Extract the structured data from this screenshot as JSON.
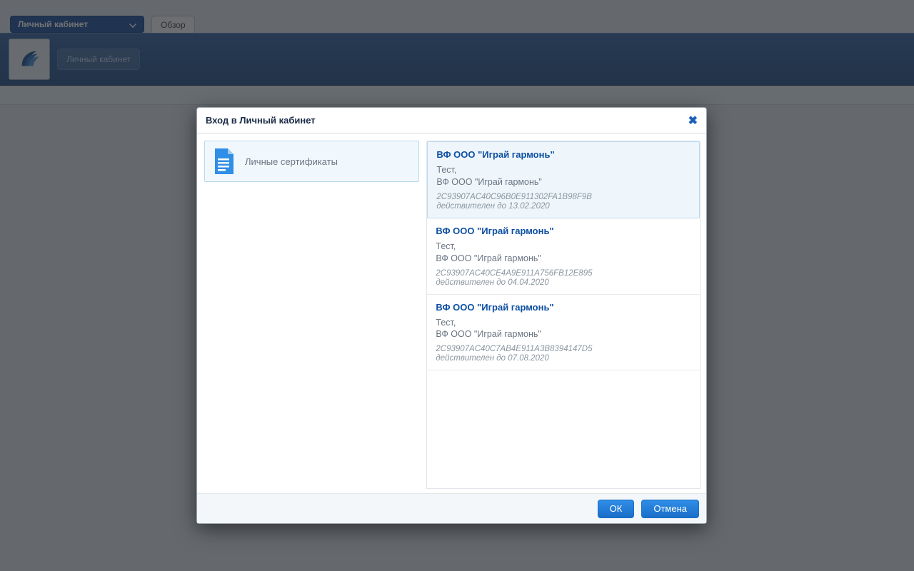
{
  "nav": {
    "dropdown_label": "Личный кабинет",
    "tab_overview": "Обзор"
  },
  "header": {
    "button_label": "Личный кабинет"
  },
  "dialog": {
    "title": "Вход в Личный кабинет",
    "category_label": "Личные сертификаты",
    "ok_label": "ОК",
    "cancel_label": "Отмена",
    "certs": [
      {
        "title": "ВФ ООО \"Играй гармонь\"",
        "line1": "Тест,",
        "line2": "ВФ ООО \"Играй гармонь\"",
        "hash": "2C93907AC40C96B0E911302FA1B98F9B",
        "valid": "действителен до 13.02.2020",
        "selected": true
      },
      {
        "title": "ВФ ООО \"Играй гармонь\"",
        "line1": "Тест,",
        "line2": "ВФ ООО \"Играй гармонь\"",
        "hash": "2C93907AC40CE4A9E911A756FB12E895",
        "valid": "действителен до 04.04.2020",
        "selected": false
      },
      {
        "title": "ВФ ООО \"Играй гармонь\"",
        "line1": "Тест,",
        "line2": "ВФ ООО \"Играй гармонь\"",
        "hash": "2C93907AC40C7AB4E911A3B8394147D5",
        "valid": "действителен до 07.08.2020",
        "selected": false
      }
    ]
  }
}
